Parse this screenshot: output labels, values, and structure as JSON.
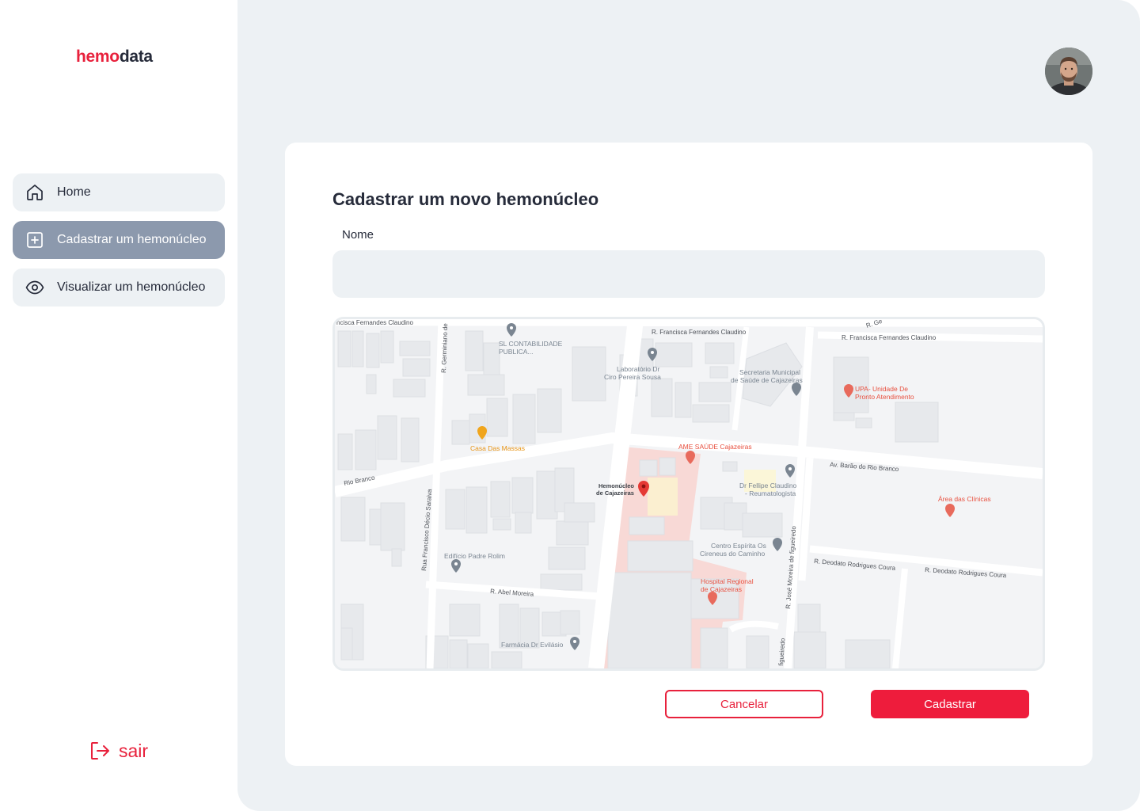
{
  "app": {
    "logo_part1": "hemo",
    "logo_part2": "data",
    "brand_color": "#e8213c"
  },
  "sidebar": {
    "items": [
      {
        "label": "Home",
        "icon": "home-icon",
        "active": false
      },
      {
        "label": "Cadastrar um hemonúcleo",
        "icon": "plus-square-icon",
        "active": true
      },
      {
        "label": "Visualizar um hemonúcleo",
        "icon": "eye-icon",
        "active": false
      }
    ],
    "logout_label": "sair"
  },
  "form": {
    "title": "Cadastrar um novo hemonúcleo",
    "name_label": "Nome",
    "name_value": "",
    "name_placeholder": "",
    "cancel_label": "Cancelar",
    "submit_label": "Cadastrar"
  },
  "map": {
    "streets": {
      "s1": "R. Francisca Fernandes Claudino",
      "s2": "R. Francisca Fernandes Claudino",
      "s3": "R. Germiniano de",
      "s4": "Av. Barão do Rio Branco",
      "s5": "Rio Branco",
      "s6": "Rua Francisco Décio Saraiva",
      "s7": "R. Abel Moreira",
      "s8": "R. Deodato Rodrigues Coura",
      "s9": "R. Deodato Rodrigues Coura",
      "s10": "R. José Moreira de figueiredo",
      "s11": "figueiredo",
      "s12": "ncisca Fernandes Claudino",
      "s13": "R. Ge"
    },
    "places": {
      "p1a": "SL CONTABILIDADE",
      "p1b": "PUBLICA...",
      "p2a": "Laboratório Dr",
      "p2b": "Ciro Pereira Sousa",
      "p3a": "Secretaria Municipal",
      "p3b": "de Saúde de Cajazeiras",
      "p4a": "UPA- Unidade De",
      "p4b": "Pronto Atendimento",
      "p5": "Casa Das Massas",
      "p6": "AME SAÚDE Cajazeiras",
      "p7a": "Hemonúcleo",
      "p7b": "de Cajazeiras",
      "p8a": "Dr Fellipe Claudino",
      "p8b": "- Reumatologista",
      "p9": "Área das Clínicas",
      "p10a": "Centro Espírita Os",
      "p10b": "Cireneus do Caminho",
      "p11": "Edifício Padre Rolim",
      "p12a": "Hospital Regional",
      "p12b": "de Cajazeiras",
      "p13": "Farmácia Dr Evilásio"
    }
  }
}
